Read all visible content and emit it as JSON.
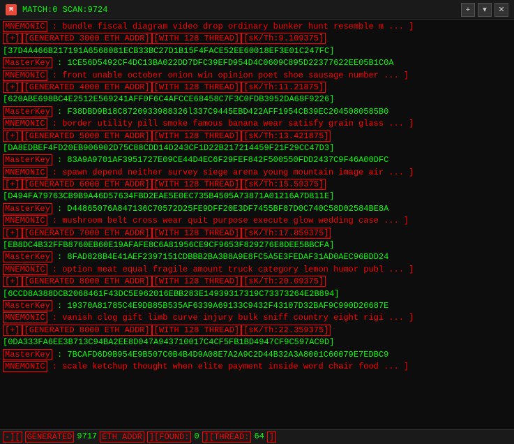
{
  "titlebar": {
    "icon": "M",
    "title": "MATCH:0 SCAN:9724",
    "close_btn": "✕",
    "new_btn": "+",
    "menu_btn": "▾"
  },
  "blocks": [
    {
      "mnemonic": "MNEMONIC : bundle fiscal diagram video drop ordinary bunker hunt resemble m ... ]",
      "generated": "[+][GENERATED 3000 ETH ADDR][WITH 128 THREAD][sK/Th:9.109375]",
      "addr": "[37D4A466B217191A6568081ECB33BC27D1B15F4FACE52EE60018EF3E01C247FC]",
      "masterkey": "MasterKey :  1CE56D5492CF4DC13BA022DD7DFC39EFD954D4C0609C895D22377622EE05B1C0A"
    },
    {
      "mnemonic": "MNEMONIC : front unable october onion win opinion poet shoe sausage number ... ]",
      "generated": "[+][GENERATED 4000 ETH ADDR][WITH 128 THREAD][sK/Th:11.21875]",
      "addr": "[620ABE698BC4E2512E569241AFF0F6C4AFCCE68458C7F3C0FDB3952DA68F9226]",
      "masterkey": "MasterKey :  F38DBD9B18C8720933988326l337C9445EBD422AFF1954CB39EC2045080585B0"
    },
    {
      "mnemonic": "MNEMONIC : border utility pill smoke famous banana wear satisfy grain glass ... ]",
      "generated": "[+][GENERATED 5000 ETH ADDR][WITH 128 THREAD][sK/Th:13.421875]",
      "addr": "[DA8EDBEF4FD20EB906902D75C88CDD14D243CF1D22B217214459F21F29CC47D3]",
      "masterkey": "MasterKey :  83A9A9701AF3951727E09CE44D4EC6F29FEF842F500550FDD2437C9F46A00DFC"
    },
    {
      "mnemonic": "MNEMONIC : spawn depend neither survey siege arena young mountain image air ... ]",
      "generated": "[+][GENERATED 6000 ETH ADDR][WITH 128 THREAD][sK/Th:15.59375]",
      "addr": "[D494FA79763CB9B9A46D57634FBD2EAE5E0EC735B4505A73871A01216A7D811E]",
      "masterkey": "MasterKey :  D44865076A847136C70572D25FE9DFF20E3DF7455BF87D0C740C58D02584BE8A"
    },
    {
      "mnemonic": "MNEMONIC : mushroom belt cross wear quit purpose execute glow wedding case ... ]",
      "generated": "[+][GENERATED 7000 ETH ADDR][WITH 128 THREAD][sK/Th:17.859375]",
      "addr": "[EB8DC4B32FFB8760EB60E19AFAFE8C6A81956CE9CF9653F829276E8DEE5BBCFA]",
      "masterkey": "MasterKey :  8FAD828B4E41AEF2397151CDBBB2BA3B8A9E8FC5A5E3FEDAF31AD0AEC96BDD24"
    },
    {
      "mnemonic": "MNEMONIC : option meat equal fragile amount truck category lemon humor publ ... ]",
      "generated": "[+][GENERATED 8000 ETH ADDR][WITH 128 THREAD][sK/Th:20.09375]",
      "addr": "[6CCD8A388DCB2068461F43DC5E962016EBB283E14939317319C73373264E2B894]",
      "masterkey": "MasterKey :  19370A81785C4E9DB85B535AF6339A69133C9432F43107D32BAF9C990D20687E"
    },
    {
      "mnemonic": "MNEMONIC : vanish clog gift limb curve injury bulk sniff country eight rigi ... ]",
      "generated": "[+][GENERATED 8000 ETH ADDR][WITH 128 THREAD][sK/Th:22.359375]",
      "addr": "[0DA333FA6EE3B713C94BA2EE8D047A943710017C4CF5FB1BD4947CF9C597AC9D]",
      "masterkey": "MasterKey :  7BCAFD6D9B954E9B507C0B4B4D9A08E7A2A9C2D44B32A3A8001C60079E7EDBC9"
    },
    {
      "mnemonic": "MNEMONIC : scale ketchup thought when elite payment inside word chair food ... ]",
      "generated": "",
      "addr": "",
      "masterkey": ""
    }
  ],
  "statusbar": {
    "minus_label": "-][",
    "generated_label": " GENERATED",
    "scan_num": "9717",
    "eth_label": " ETH ADDR ",
    "found_label": "][FOUND:",
    "found_val": "0",
    "thread_label": "][THREAD:",
    "thread_val": "64",
    "end_bracket": "]"
  }
}
